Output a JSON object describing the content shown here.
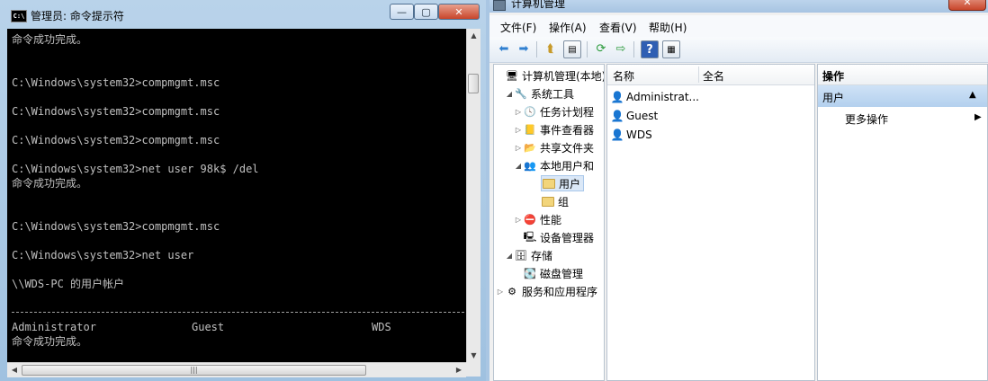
{
  "cmd": {
    "title": "管理员: 命令提示符",
    "icon_label": "C:\\",
    "lines": [
      "命令成功完成。",
      "C:\\Windows\\system32>compmgmt.msc",
      "C:\\Windows\\system32>compmgmt.msc",
      "C:\\Windows\\system32>compmgmt.msc",
      "C:\\Windows\\system32>net user 98k$ /del",
      "命令成功完成。",
      "C:\\Windows\\system32>compmgmt.msc",
      "C:\\Windows\\system32>net user",
      "\\\\WDS-PC 的用户帐户",
      "命令成功完成。"
    ],
    "user_columns": [
      "Administrator",
      "Guest",
      "WDS"
    ],
    "window_buttons": {
      "minimize": "—",
      "maximize": "▢",
      "close": "✕"
    }
  },
  "mmc": {
    "title": "计算机管理",
    "close_glyph": "✕",
    "menu": [
      "文件(F)",
      "操作(A)",
      "查看(V)",
      "帮助(H)"
    ],
    "tree": {
      "root": "计算机管理(本地)",
      "system_tools": "系统工具",
      "task_scheduler": "任务计划程",
      "event_viewer": "事件查看器",
      "shared_folders": "共享文件夹",
      "local_users": "本地用户和",
      "users": "用户",
      "groups": "组",
      "performance": "性能",
      "device_manager": "设备管理器",
      "storage": "存储",
      "disk_management": "磁盘管理",
      "services_apps": "服务和应用程序"
    },
    "list": {
      "columns": [
        "名称",
        "全名"
      ],
      "rows": [
        {
          "name": "Administrat...",
          "fullname": ""
        },
        {
          "name": "Guest",
          "fullname": ""
        },
        {
          "name": "WDS",
          "fullname": ""
        }
      ]
    },
    "actions": {
      "header": "操作",
      "section": "用户",
      "more": "更多操作"
    }
  }
}
